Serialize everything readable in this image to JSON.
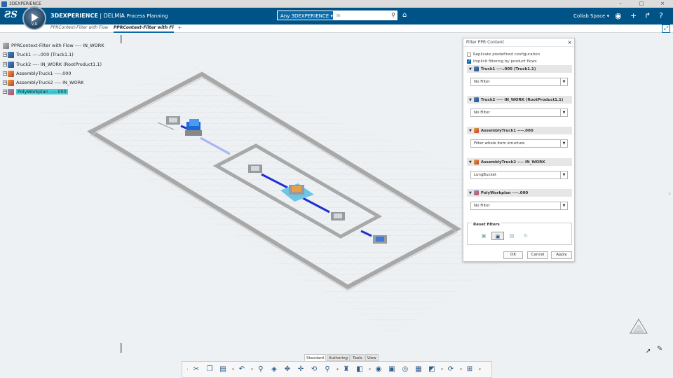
{
  "os": {
    "title": "3DEXPERIENCE",
    "controls": [
      "–",
      "□",
      "×"
    ]
  },
  "header": {
    "compass_label": "V,R",
    "brand_bold": "3DEXPERIENCE",
    "brand_app": "| DELMIA",
    "brand_role": "Process Planning",
    "search_scope": "Any 3DEXPERIENCE ▾",
    "search_placeholder": "In",
    "collab_space": "Collab Space ▾"
  },
  "tabs": [
    {
      "label": "PPRContext-Filter with Flow"
    },
    {
      "label": "PPRContext-Filter with Flo"
    }
  ],
  "tree": {
    "root": "PPRContext-Filter with Flow ---- IN_WORK",
    "items": [
      {
        "label": "Truck1 ----.000 (Truck1.1)",
        "icon": "product-icon"
      },
      {
        "label": "Truck2 ---- IN_WORK (RootProduct1.1)",
        "icon": "product-icon"
      },
      {
        "label": "AssemblyTruck1 ----.000",
        "icon": "process-icon"
      },
      {
        "label": "AssemblyTruck2 ---- IN_WORK",
        "icon": "process-icon"
      },
      {
        "label": "PolyWorkplan ----.000",
        "icon": "workplan-icon"
      }
    ]
  },
  "dialog": {
    "title": "Filter PPR Content",
    "replicate_label": "Replicate predefined configuration",
    "replicate_checked": false,
    "implicit_label": "Implicit filtering by product flows",
    "implicit_checked": true,
    "sections": [
      {
        "title": "Truck1 ----.000 (Truck1.1)",
        "value": "No Filter"
      },
      {
        "title": "Truck2 ---- IN_WORK (RootProduct1.1)",
        "value": "No Filter"
      },
      {
        "title": "AssemblyTruck1 ----.000",
        "value": "Filter whole item structure"
      },
      {
        "title": "AssemblyTruck2 ---- IN_WORK",
        "value": "LongBucket"
      },
      {
        "title": "PolyWorkplan ----.000",
        "value": "No Filter"
      }
    ],
    "reset_label": "Reset filters",
    "ok": "OK",
    "cancel": "Cancel",
    "apply": "Apply"
  },
  "action_sections": [
    "Standard",
    "Authoring",
    "Tools",
    "View"
  ],
  "colors": {
    "header": "#005386",
    "accent": "#0a6aa8",
    "selection": "#3fd1d8",
    "flow": "#1f2fd0"
  }
}
